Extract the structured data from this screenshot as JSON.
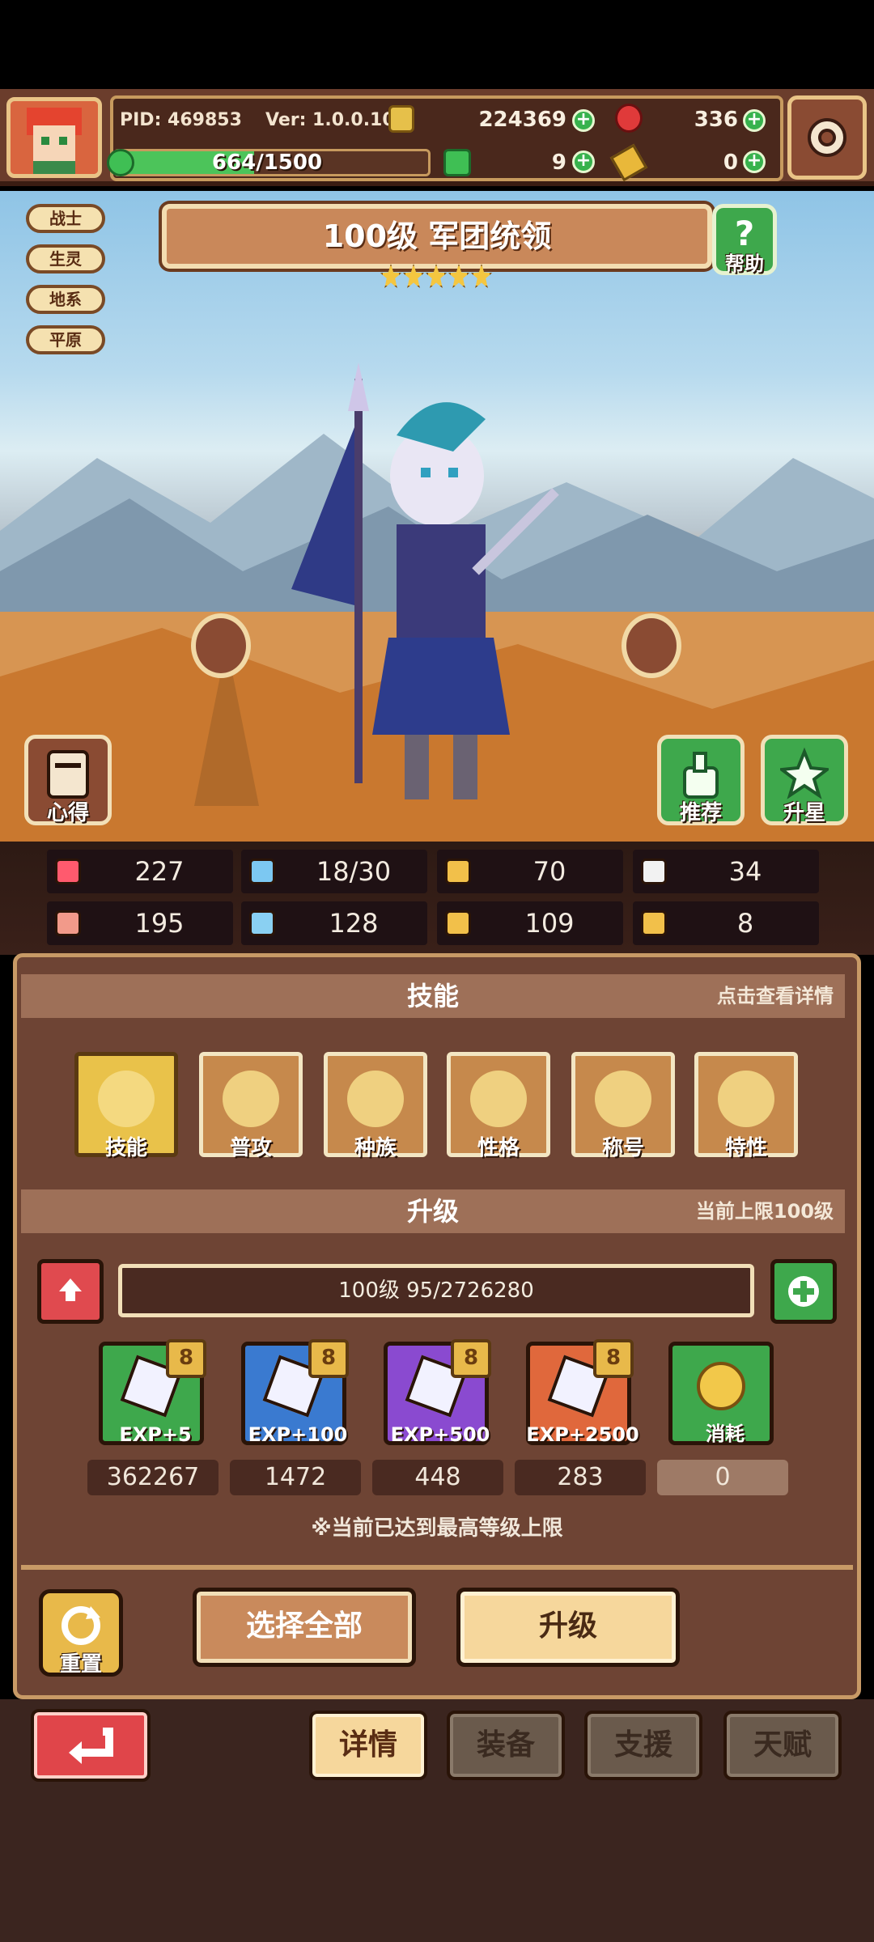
{
  "top_bar": {
    "pid": "PID: 469853",
    "version": "Ver: 1.0.0.10",
    "gold": "224369",
    "gems": "336",
    "stamina": "664/1500",
    "stamina_fraction": 0.443,
    "clover": "9",
    "key": "0"
  },
  "tags": [
    "战士",
    "生灵",
    "地系",
    "平原"
  ],
  "hero": {
    "title": "100级 军团统领",
    "stars": 5,
    "help_label": "帮助"
  },
  "scene_buttons": {
    "insight": "心得",
    "recommend": "推荐",
    "star_up": "升星"
  },
  "stats": [
    {
      "icon": "heart-icon",
      "value": "227"
    },
    {
      "icon": "drop-icon",
      "value": "18/30"
    },
    {
      "icon": "shield-icon",
      "value": "70"
    },
    {
      "icon": "wing-icon",
      "value": "34"
    },
    {
      "icon": "fist-icon",
      "value": "195"
    },
    {
      "icon": "book-icon",
      "value": "128"
    },
    {
      "icon": "boot-icon",
      "value": "109"
    },
    {
      "icon": "horseshoe-icon",
      "value": "8"
    }
  ],
  "skills_section": {
    "title": "技能",
    "note": "点击查看详情",
    "items": [
      "技能",
      "普攻",
      "种族",
      "性格",
      "称号",
      "特性"
    ]
  },
  "upgrade_section": {
    "title": "升级",
    "note": "当前上限100级",
    "progress_text": "100级 95/2726280",
    "items": [
      {
        "label": "EXP+5",
        "count": "362267",
        "badge": "8"
      },
      {
        "label": "EXP+100",
        "count": "1472",
        "badge": "8"
      },
      {
        "label": "EXP+500",
        "count": "448",
        "badge": "8"
      },
      {
        "label": "EXP+2500",
        "count": "283",
        "badge": "8"
      },
      {
        "label": "消耗",
        "count": "0"
      }
    ],
    "max_notice": "※当前已达到最高等级上限"
  },
  "actions": {
    "reset": "重置",
    "select_all": "选择全部",
    "upgrade": "升级"
  },
  "tabs": [
    "详情",
    "装备",
    "支援",
    "天赋"
  ],
  "colors": {
    "panel_brown": "#6e4434",
    "accent_green": "#37b24d",
    "back_red": "#e0454a",
    "tab_active": "#f6d79c"
  }
}
